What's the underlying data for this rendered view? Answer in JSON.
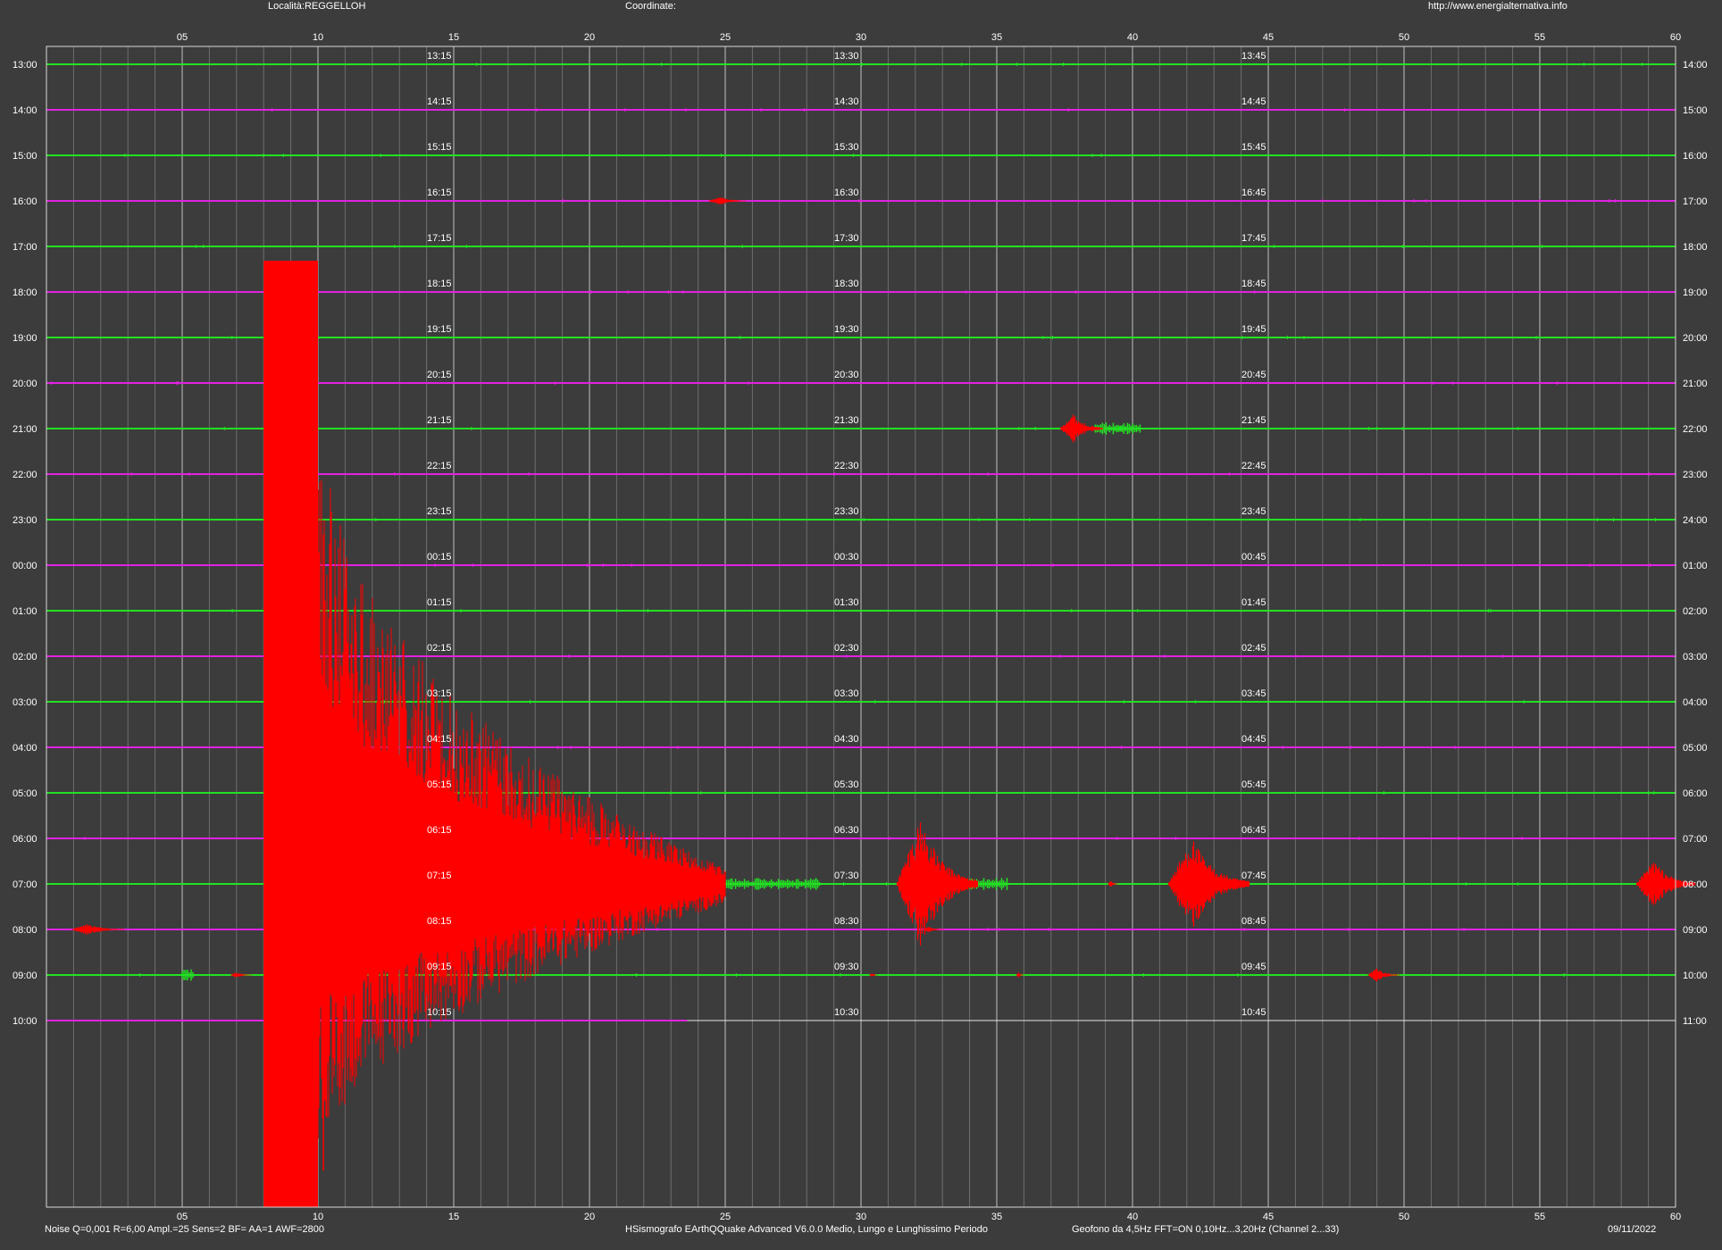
{
  "header": {
    "location": "Località:REGGELLOH",
    "coordinates": "Coordinate:",
    "url": "http://www.energialternativa.info"
  },
  "footer": {
    "settings": "Noise Q=0,001 R=6,00 Ampl.=25 Sens=2 BF= AA=1 AWF=2800",
    "software": "HSismografo  EArthQQuake Advanced V6.0.0  Medio, Lungo e Lunghissimo Periodo",
    "sensor": "Geofono da 4,5Hz FFT=ON 0,10Hz...3,20Hz      (Channel 2...33)",
    "date": "09/11/2022"
  },
  "colors": {
    "background": "#3c3c3c",
    "trace_a": "#22e122",
    "trace_b": "#e122e1",
    "event": "#ff0000",
    "grid_major": "#d8d8d8",
    "grid_minor": "#6e6e6e"
  },
  "chart_data": {
    "type": "helicorder",
    "minutes_per_row": 60,
    "x_range": [
      0,
      60
    ],
    "x_ticks": [
      "05",
      "10",
      "15",
      "20",
      "25",
      "30",
      "35",
      "40",
      "45",
      "50",
      "55",
      "60"
    ],
    "rows": [
      {
        "left": "13:00",
        "right": "14:00",
        "q15": "13:15",
        "q30": "13:30",
        "q45": "13:45",
        "color": "trace_a"
      },
      {
        "left": "14:00",
        "right": "15:00",
        "q15": "14:15",
        "q30": "14:30",
        "q45": "14:45",
        "color": "trace_b"
      },
      {
        "left": "15:00",
        "right": "16:00",
        "q15": "15:15",
        "q30": "15:30",
        "q45": "15:45",
        "color": "trace_a"
      },
      {
        "left": "16:00",
        "right": "17:00",
        "q15": "16:15",
        "q30": "16:30",
        "q45": "16:45",
        "color": "trace_b"
      },
      {
        "left": "17:00",
        "right": "18:00",
        "q15": "17:15",
        "q30": "17:30",
        "q45": "17:45",
        "color": "trace_a"
      },
      {
        "left": "18:00",
        "right": "19:00",
        "q15": "18:15",
        "q30": "18:30",
        "q45": "18:45",
        "color": "trace_b"
      },
      {
        "left": "19:00",
        "right": "20:00",
        "q15": "19:15",
        "q30": "19:30",
        "q45": "19:45",
        "color": "trace_a"
      },
      {
        "left": "20:00",
        "right": "21:00",
        "q15": "20:15",
        "q30": "20:30",
        "q45": "20:45",
        "color": "trace_b"
      },
      {
        "left": "21:00",
        "right": "22:00",
        "q15": "21:15",
        "q30": "21:30",
        "q45": "21:45",
        "color": "trace_a"
      },
      {
        "left": "22:00",
        "right": "23:00",
        "q15": "22:15",
        "q30": "22:30",
        "q45": "22:45",
        "color": "trace_b"
      },
      {
        "left": "23:00",
        "right": "24:00",
        "q15": "23:15",
        "q30": "23:30",
        "q45": "23:45",
        "color": "trace_a"
      },
      {
        "left": "00:00",
        "right": "01:00",
        "q15": "00:15",
        "q30": "00:30",
        "q45": "00:45",
        "color": "trace_b"
      },
      {
        "left": "01:00",
        "right": "02:00",
        "q15": "01:15",
        "q30": "01:30",
        "q45": "01:45",
        "color": "trace_a"
      },
      {
        "left": "02:00",
        "right": "03:00",
        "q15": "02:15",
        "q30": "02:30",
        "q45": "02:45",
        "color": "trace_b"
      },
      {
        "left": "03:00",
        "right": "04:00",
        "q15": "03:15",
        "q30": "03:30",
        "q45": "03:45",
        "color": "trace_a"
      },
      {
        "left": "04:00",
        "right": "05:00",
        "q15": "04:15",
        "q30": "04:30",
        "q45": "04:45",
        "color": "trace_b"
      },
      {
        "left": "05:00",
        "right": "06:00",
        "q15": "05:15",
        "q30": "05:30",
        "q45": "05:45",
        "color": "trace_a"
      },
      {
        "left": "06:00",
        "right": "07:00",
        "q15": "06:15",
        "q30": "06:30",
        "q45": "06:45",
        "color": "trace_b"
      },
      {
        "left": "07:00",
        "right": "08:00",
        "q15": "07:15",
        "q30": "07:30",
        "q45": "07:45",
        "color": "trace_a"
      },
      {
        "left": "08:00",
        "right": "09:00",
        "q15": "08:15",
        "q30": "08:30",
        "q45": "08:45",
        "color": "trace_b"
      },
      {
        "left": "09:00",
        "right": "10:00",
        "q15": "09:15",
        "q30": "09:30",
        "q45": "09:45",
        "color": "trace_a"
      },
      {
        "left": "10:00",
        "right": "11:00",
        "q15": "10:15",
        "q30": "10:30",
        "q45": "10:45",
        "color": "trace_b",
        "data_end_minute": 23.6
      }
    ],
    "events": [
      {
        "row": 3,
        "minute": 24.8,
        "duration": 1.4,
        "amplitude": 0.2
      },
      {
        "row": 8,
        "minute": 37.8,
        "duration": 1.6,
        "amplitude": 0.7
      },
      {
        "row": 8,
        "minute": 39.5,
        "duration": 1.2,
        "amplitude": 0.15,
        "color": "trace_a"
      },
      {
        "row": 18,
        "minute": 32.2,
        "duration": 3.0,
        "amplitude": 3.0
      },
      {
        "row": 18,
        "minute": 42.2,
        "duration": 3.0,
        "amplitude": 2.1
      },
      {
        "row": 18,
        "minute": 59.2,
        "duration": 2.2,
        "amplitude": 1.1
      },
      {
        "row": 18,
        "minute": 39.2,
        "duration": 0.4,
        "amplitude": 0.15
      },
      {
        "row": 19,
        "minute": 1.5,
        "duration": 2.0,
        "amplitude": 0.25
      },
      {
        "row": 19,
        "minute": 16.8,
        "duration": 1.2,
        "amplitude": 0.4
      },
      {
        "row": 19,
        "minute": 32.5,
        "duration": 0.8,
        "amplitude": 0.12
      },
      {
        "row": 20,
        "minute": 7.0,
        "duration": 0.8,
        "amplitude": 0.15
      },
      {
        "row": 20,
        "minute": 30.4,
        "duration": 0.3,
        "amplitude": 0.12
      },
      {
        "row": 20,
        "minute": 35.8,
        "duration": 0.3,
        "amplitude": 0.12
      },
      {
        "row": 20,
        "minute": 49.0,
        "duration": 1.2,
        "amplitude": 0.3
      }
    ],
    "main_event": {
      "start_row": 4,
      "start_minute": 8.0,
      "saturated_until_minute": 10.0,
      "coda_end_minute": 25.0,
      "coda_row": 18,
      "spikes": [
        {
          "minute": 10.2,
          "amplitude": 14
        },
        {
          "minute": 11.2,
          "amplitude": 9
        },
        {
          "minute": 11.6,
          "amplitude": 7
        },
        {
          "minute": 14.0,
          "amplitude": 5.4
        },
        {
          "minute": 20.7,
          "amplitude": 1.4
        }
      ]
    },
    "green_bursts": [
      {
        "row": 18,
        "minute": 24.0,
        "duration": 4.5
      },
      {
        "row": 18,
        "minute": 33.8,
        "duration": 1.6
      },
      {
        "row": 20,
        "minute": 5.0,
        "duration": 0.4
      },
      {
        "row": 8,
        "minute": 38.5,
        "duration": 1.8
      }
    ]
  }
}
